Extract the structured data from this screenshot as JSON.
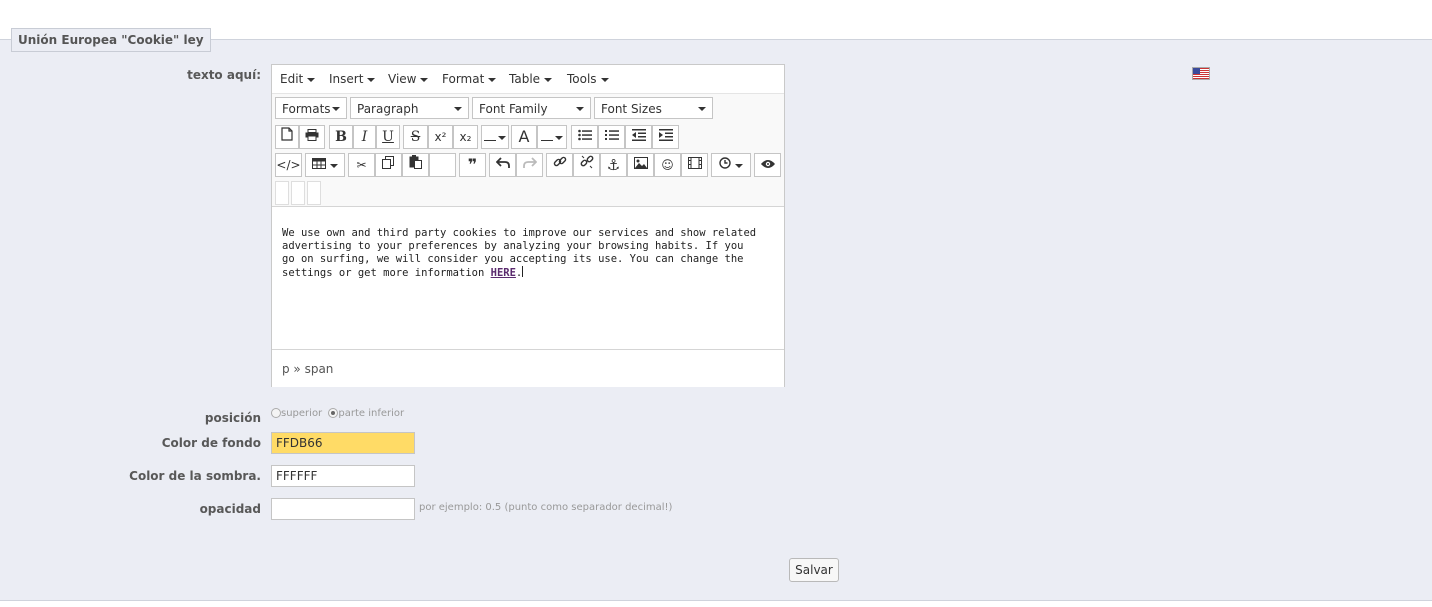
{
  "section": {
    "legend": "Unión Europea \"Cookie\" ley"
  },
  "labels": {
    "text_here": "texto aquí:",
    "position": "posición",
    "bg_color": "Color de fondo",
    "shadow_color": "Color de la sombra.",
    "opacity": "opacidad"
  },
  "language_flag": "us-flag-icon",
  "editor": {
    "menus": [
      "Edit",
      "Insert",
      "View",
      "Format",
      "Table",
      "Tools"
    ],
    "dropdowns": [
      "Formats",
      "Paragraph",
      "Font Family",
      "Font Sizes"
    ],
    "content_text": "We use own and third party cookies to improve our services and show related advertising to your preferences by analyzing your browsing habits. If you go on surfing, we will consider you accepting its use. You can change the settings or get more information ",
    "content_link": "HERE",
    "content_end": ".",
    "status_path": "p » span"
  },
  "position_options": {
    "top": "superior",
    "bottom": "parte inferior",
    "selected": "parte inferior"
  },
  "fields": {
    "bg_color_value": "FFDB66",
    "shadow_color_value": "FFFFFF",
    "opacity_value": "",
    "opacity_hint": "por ejemplo: 0.5 (punto como separador decimal!)"
  },
  "colors": {
    "bg_color_swatch": "#FFDB66",
    "shadow_color_swatch": "#FFFFFF"
  },
  "actions": {
    "save_label": "Salvar"
  }
}
